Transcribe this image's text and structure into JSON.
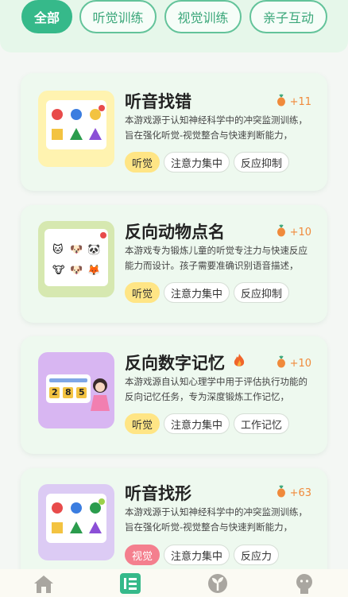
{
  "filters": [
    "全部",
    "听觉训练",
    "视觉训练",
    "亲子互动"
  ],
  "colors": {
    "accent": "#36b98a",
    "points": "#f08a3b",
    "tag_hearing": "#ffe585",
    "tag_visual": "#f47f8e"
  },
  "cards": [
    {
      "title": "听音找错",
      "points": "+11",
      "desc": "本游戏源于认知神经科学中的冲突监测训练，旨在强化听觉-视觉整合与快速判断能力，",
      "tags": [
        "听觉",
        "注意力集中",
        "反应抑制"
      ],
      "thumb_icon": "shape-grid-icon"
    },
    {
      "title": "反向动物点名",
      "points": "+10",
      "desc": "本游戏专为锻炼儿童的听觉专注力与快速反应能力而设计。孩子需要准确识别语音描述，",
      "tags": [
        "听觉",
        "注意力集中",
        "反应抑制"
      ],
      "thumb_icon": "animal-grid-icon"
    },
    {
      "title": "反向数字记忆",
      "points": "+10",
      "desc": "本游戏源自认知心理学中用于评估执行功能的反向记忆任务，专为深度锻炼工作记忆，",
      "tags": [
        "听觉",
        "注意力集中",
        "工作记忆"
      ],
      "thumb_icon": "number-board-icon",
      "thumb_digits": [
        "2",
        "8",
        "5"
      ]
    },
    {
      "title": "听音找形",
      "points": "+63",
      "desc": "本游戏源于认知神经科学中的冲突监测训练，旨在强化听觉-视觉整合与快速判断能力，",
      "tags": [
        "视觉",
        "注意力集中",
        "反应力"
      ],
      "thumb_icon": "shape-grid-icon"
    }
  ],
  "tabbar": [
    "home-icon",
    "list-icon",
    "sprout-icon",
    "profile-icon"
  ]
}
